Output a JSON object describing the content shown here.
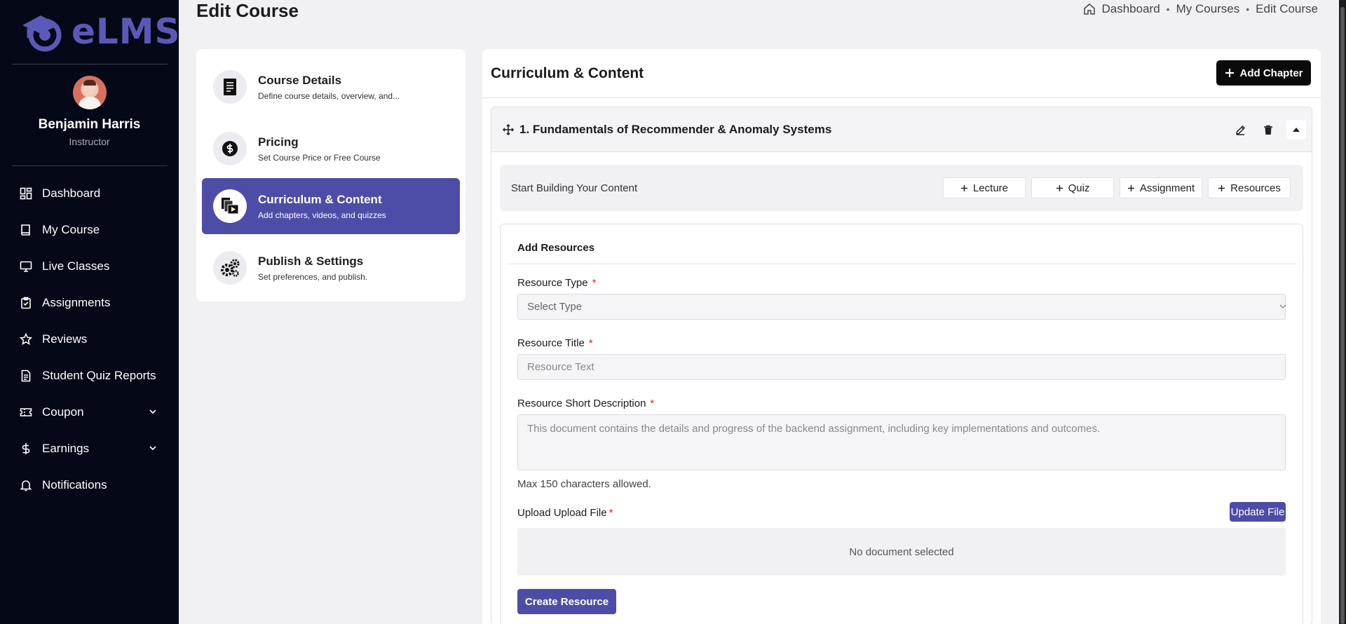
{
  "app": {
    "logo_text": "eLMS",
    "brand_color": "#4d4da7"
  },
  "user": {
    "name": "Benjamin Harris",
    "role": "Instructor"
  },
  "sidebar": {
    "items": [
      {
        "label": "Dashboard",
        "icon": "dashboard-icon"
      },
      {
        "label": "My Course",
        "icon": "book-icon"
      },
      {
        "label": "Live Classes",
        "icon": "monitor-icon"
      },
      {
        "label": "Assignments",
        "icon": "clipboard-icon"
      },
      {
        "label": "Reviews",
        "icon": "star-icon"
      },
      {
        "label": "Student Quiz Reports",
        "icon": "report-icon"
      },
      {
        "label": "Coupon",
        "icon": "ticket-icon",
        "expandable": true
      },
      {
        "label": "Earnings",
        "icon": "dollar-icon",
        "expandable": true
      },
      {
        "label": "Notifications",
        "icon": "bell-icon"
      }
    ]
  },
  "header": {
    "title": "Edit Course",
    "breadcrumb": [
      "Dashboard",
      "My Courses",
      "Edit Course"
    ]
  },
  "steps": [
    {
      "title": "Course Details",
      "subtitle": "Define course details, overview, and...",
      "icon": "document-icon",
      "active": false
    },
    {
      "title": "Pricing",
      "subtitle": "Set Course Price or Free Course",
      "icon": "dollar-coin-icon",
      "active": false
    },
    {
      "title": "Curriculum & Content",
      "subtitle": "Add chapters, videos, and quizzes",
      "icon": "video-files-icon",
      "active": true
    },
    {
      "title": "Publish & Settings",
      "subtitle": "Set preferences, and publish.",
      "icon": "gears-icon",
      "active": false
    }
  ],
  "curriculum": {
    "title": "Curriculum & Content",
    "add_chapter_label": "Add Chapter",
    "chapter": {
      "title": "1. Fundamentals of Recommender & Anomaly Systems"
    },
    "builder": {
      "label": "Start Building Your Content",
      "buttons": [
        "Lecture",
        "Quiz",
        "Assignment",
        "Resources"
      ]
    },
    "resource_form": {
      "title": "Add Resources",
      "type_label": "Resource Type",
      "type_value": "Select Type",
      "title_label": "Resource Title",
      "title_placeholder": "Resource Text",
      "desc_label": "Resource Short Description",
      "desc_placeholder": "This document contains the details and progress of the backend assignment, including key implementations and outcomes.",
      "desc_hint": "Max 150 characters allowed.",
      "upload_label": "Upload Upload File",
      "update_file_label": "Update File",
      "no_document": "No document selected",
      "create_label": "Create Resource"
    }
  }
}
